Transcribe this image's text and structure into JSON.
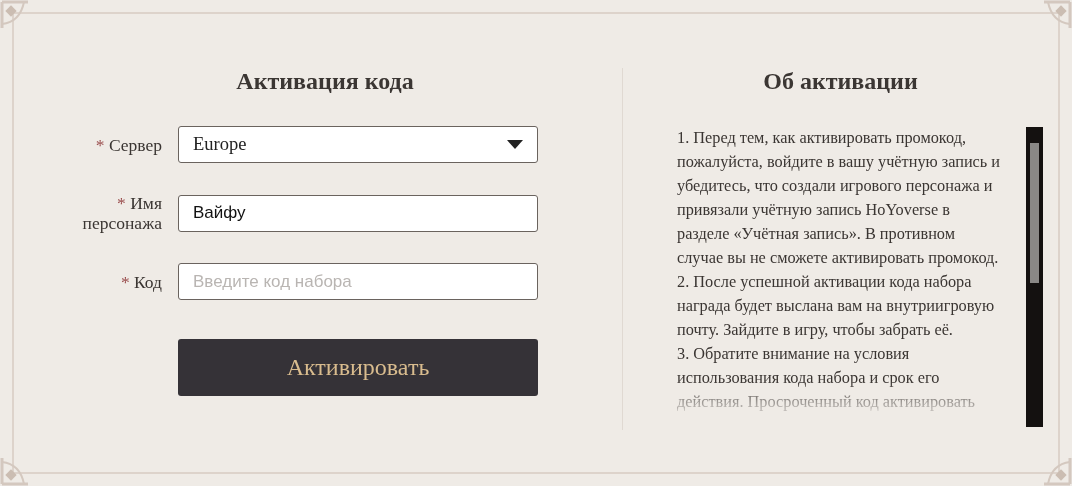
{
  "activation": {
    "title": "Активация кода",
    "fields": [
      {
        "kind": "select",
        "required_mark": "*",
        "label": "Сервер",
        "value": "Europe"
      },
      {
        "kind": "text",
        "required_mark": "*",
        "label": "Имя персонажа",
        "value": "Вайфу"
      },
      {
        "kind": "text",
        "required_mark": "*",
        "label": "Код",
        "placeholder": "Введите код набора"
      }
    ],
    "button": "Активировать"
  },
  "about": {
    "title": "Об активации",
    "paragraphs": [
      "1. Перед тем, как активировать промокод, пожалуйста, войдите в вашу учётную запись и убедитесь, что создали игрового персонажа и привязали учётную запись HoYoverse в разделе «Учётная запись». В противном случае вы не сможете активировать промокод.",
      "2. После успешной активации кода набора награда будет выслана вам на внутриигровую почту. Зайдите в игру, чтобы забрать её.",
      "3. Обратите внимание на условия использования кода набора и срок его действия. Просроченный код активировать"
    ]
  }
}
